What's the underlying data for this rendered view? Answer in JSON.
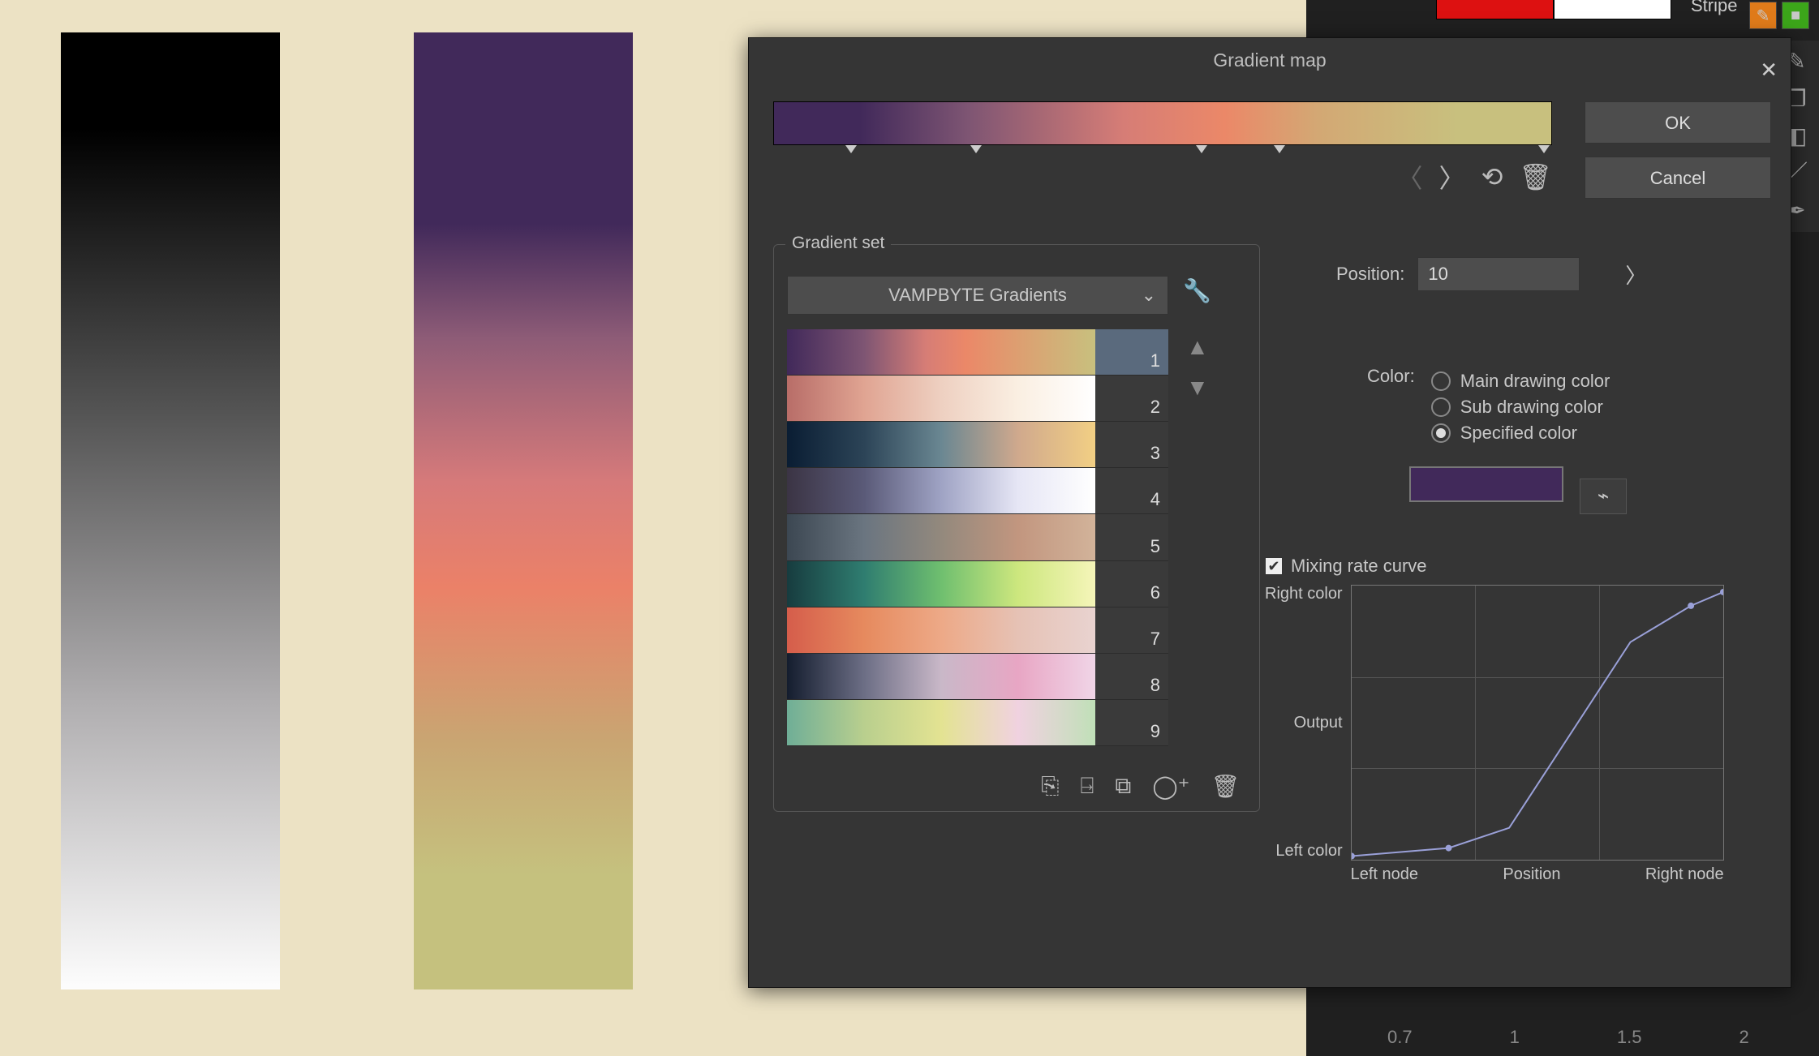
{
  "canvas": {
    "bg": "#ece2c4"
  },
  "app_strip": {
    "color_chips": [
      "#d11",
      "#ffffff"
    ],
    "stripe_label": "Stripe",
    "bottom_values": [
      "0.7",
      "1",
      "1.5",
      "2"
    ]
  },
  "dialog": {
    "title": "Gradient map",
    "ok": "OK",
    "cancel": "Cancel",
    "gradient_stops_percent": [
      10,
      26,
      55,
      65,
      99
    ],
    "gradient_set": {
      "label": "Gradient set",
      "dropdown_value": "VAMPBYTE Gradients",
      "selected_index": 1,
      "items": [
        {
          "num": "1",
          "css": "linear-gradient(to right,#41295a 0%, #7e5573 25%, #d67d76 45%, #eb8868 58%, #c8c07e 100%)"
        },
        {
          "num": "2",
          "css": "linear-gradient(to right,#b86d68,#e0a492,#eed0c1,#faefe2,#fff)"
        },
        {
          "num": "3",
          "css": "linear-gradient(to right,#0a1d33,#2c4457,#6a8792,#d0a98d,#f2cf84)"
        },
        {
          "num": "4",
          "css": "linear-gradient(to right,#3b3444,#5a5a78,#9fa3c4,#e6e6f5,#ffffff)"
        },
        {
          "num": "5",
          "css": "linear-gradient(to right,#3c4752,#6a7580,#93897d,#c2967f,#d2b39a)"
        },
        {
          "num": "6",
          "css": "linear-gradient(to right,#173c3f,#2f7d70,#6fbf6f,#cde77e,#f5f5b9)"
        },
        {
          "num": "7",
          "css": "linear-gradient(to right,#d55d4b,#e68a5e,#eda987,#e6c2b5,#e9d3d0)"
        },
        {
          "num": "8",
          "css": "linear-gradient(to right,#141d2e,#6c6e85,#c9b8c8,#e8a6c4,#f0d5e7)"
        },
        {
          "num": "9",
          "css": "linear-gradient(to right,#6fae97,#b9cf8e,#e3e392,#f0d2e0,#c0e0b8)"
        }
      ],
      "bottom_icons": [
        "replace-icon",
        "export-icon",
        "duplicate-icon",
        "add-icon",
        "delete-icon"
      ]
    },
    "position": {
      "label": "Position:",
      "value": "10"
    },
    "color": {
      "label": "Color:",
      "options": [
        "Main drawing color",
        "Sub drawing color",
        "Specified color"
      ],
      "selected": 2,
      "specified_hex": "#41295a"
    },
    "mixing": {
      "checkbox_label": "Mixing rate curve",
      "checked": true,
      "y_top": "Right color",
      "y_mid": "Output",
      "y_bottom": "Left color",
      "x_labels": [
        "Left node",
        "Position",
        "Right node"
      ]
    }
  }
}
